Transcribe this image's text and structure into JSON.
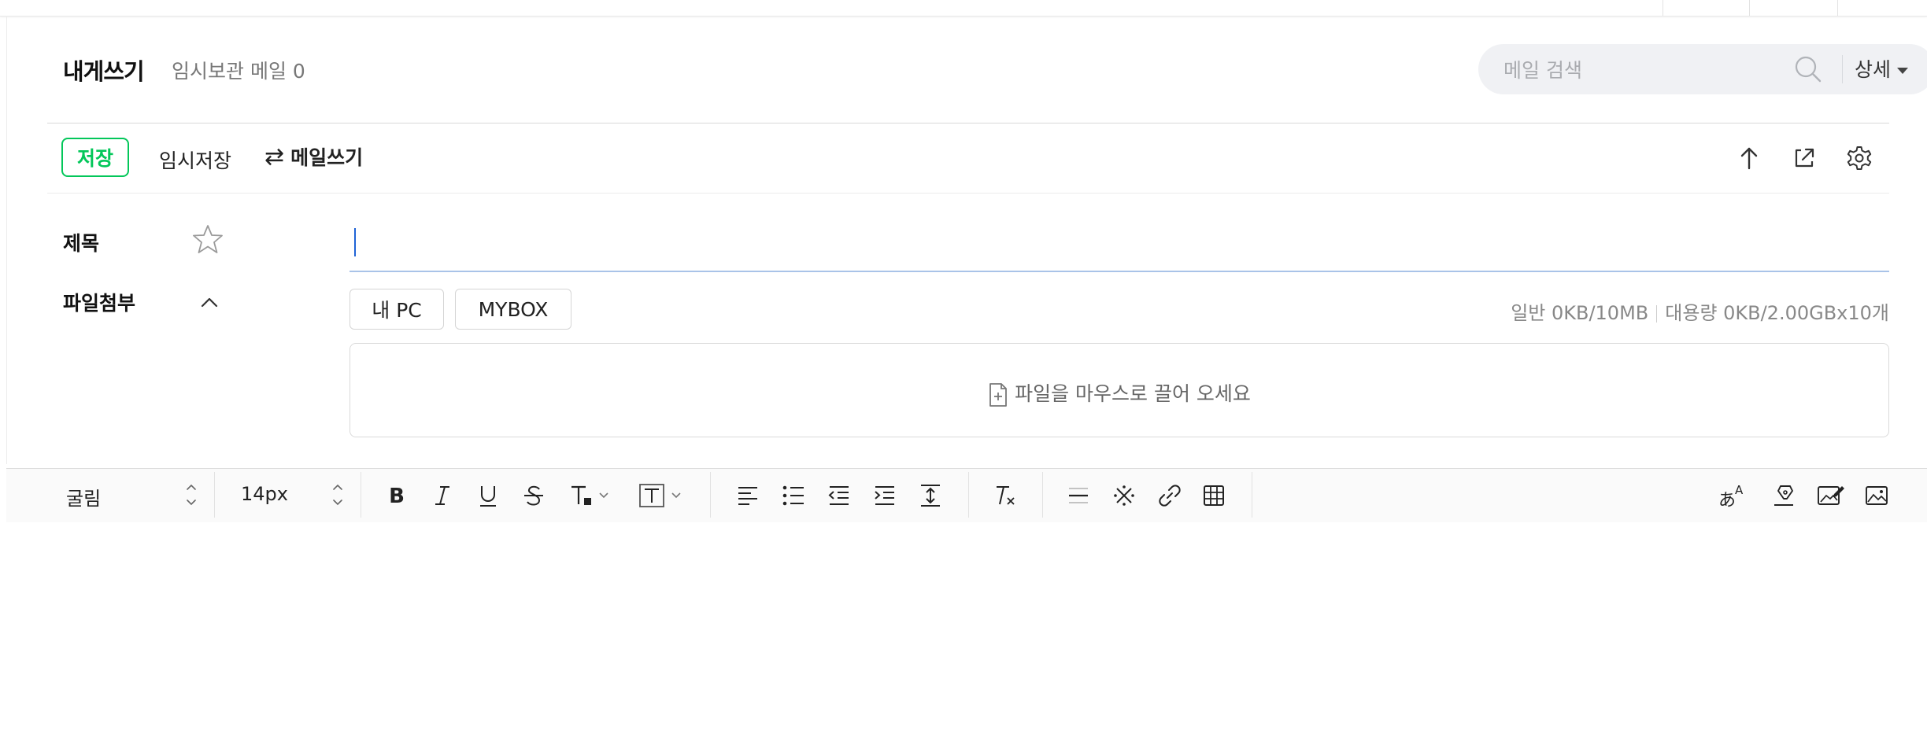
{
  "header": {
    "title": "내게쓰기",
    "drafts_label": "임시보관 메일 0"
  },
  "search": {
    "placeholder": "메일 검색",
    "detail_label": "상세"
  },
  "toolbar": {
    "save_label": "저장",
    "temp_save_label": "임시저장",
    "write_mail_label": "메일쓰기"
  },
  "form": {
    "subject_label": "제목",
    "subject_value": "",
    "attach_label": "파일첨부",
    "my_pc_label": "내 PC",
    "mybox_label": "MYBOX",
    "quota_general": "일반 0KB/10MB",
    "quota_large": "대용량 0KB/2.00GBx10개",
    "dropzone_text": "파일을 마우스로 끌어 오세요"
  },
  "editor": {
    "font_family": "굴림",
    "font_size": "14px"
  },
  "icons": {
    "toolbar": [
      "arrow-up-icon",
      "popout-icon",
      "settings-icon"
    ],
    "editor": [
      "bold-icon",
      "italic-icon",
      "underline-icon",
      "strikethrough-icon",
      "text-color-icon",
      "text-background-icon",
      "align-left-icon",
      "bullet-list-icon",
      "outdent-icon",
      "indent-icon",
      "line-height-icon",
      "clear-format-icon",
      "horizontal-rule-icon",
      "special-char-icon",
      "link-icon",
      "table-icon",
      "translate-icon",
      "signature-icon",
      "image-edit-icon",
      "image-icon"
    ]
  },
  "colors": {
    "accent_green": "#03c75a",
    "focus_blue": "#a9c3e8"
  }
}
